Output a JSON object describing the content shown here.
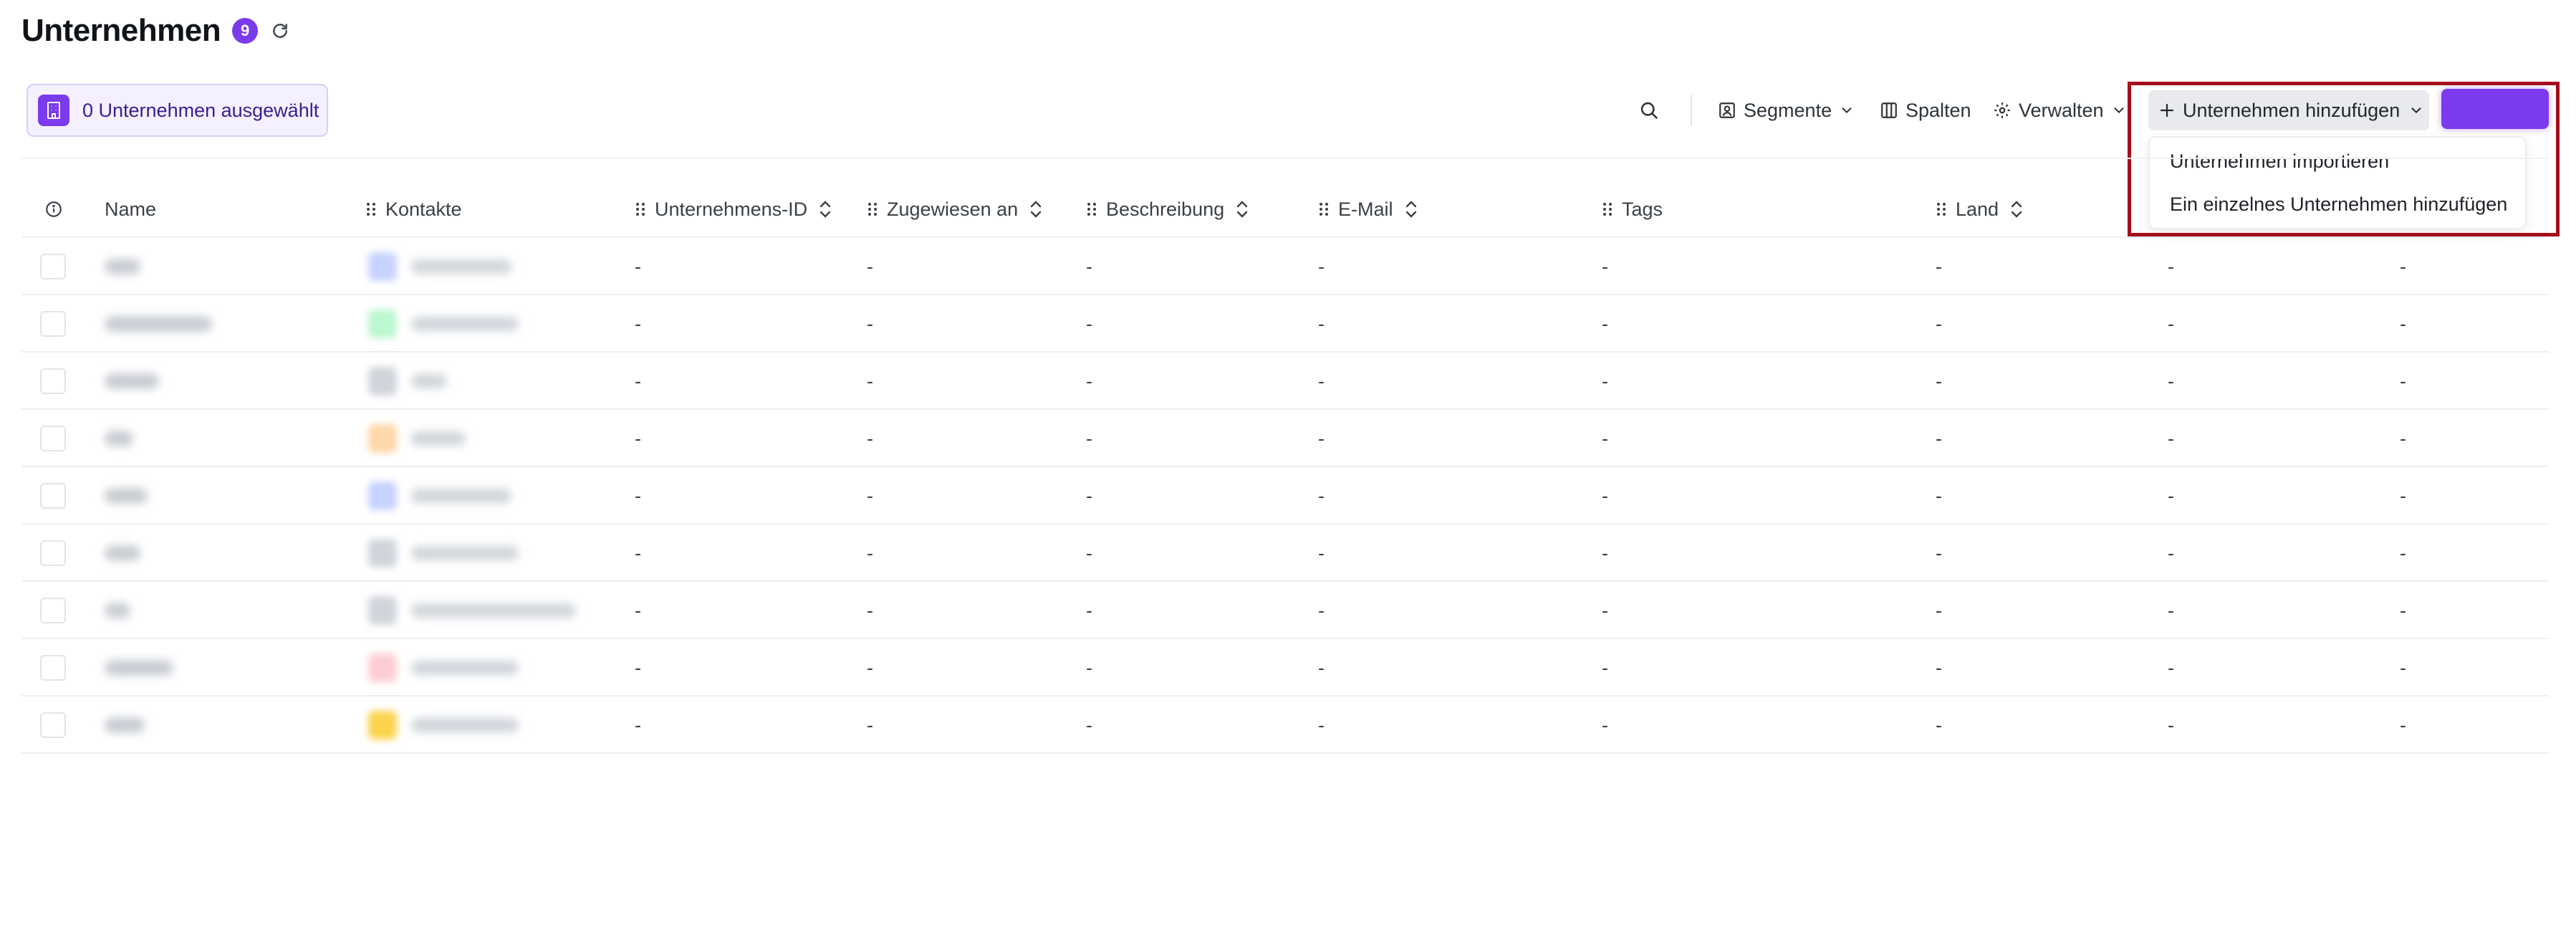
{
  "header": {
    "title": "Unternehmen",
    "count": "9"
  },
  "selection": {
    "label": "0 Unternehmen ausgewählt"
  },
  "toolbar": {
    "segmente": "Segmente",
    "spalten": "Spalten",
    "verwalten": "Verwalten",
    "add_label": "Unternehmen hinzufügen"
  },
  "dropdown": {
    "items": [
      "Unternehmen importieren",
      "Ein einzelnes Unternehmen hinzufügen"
    ]
  },
  "table": {
    "columns": [
      "Name",
      "Kontakte",
      "Unternehmens-ID",
      "Zugewiesen an",
      "Beschreibung",
      "E-Mail",
      "Tags",
      "Land"
    ],
    "placeholder": "-"
  },
  "colors": {
    "accent": "#7c3aed",
    "highlight": "#a30f1c"
  }
}
